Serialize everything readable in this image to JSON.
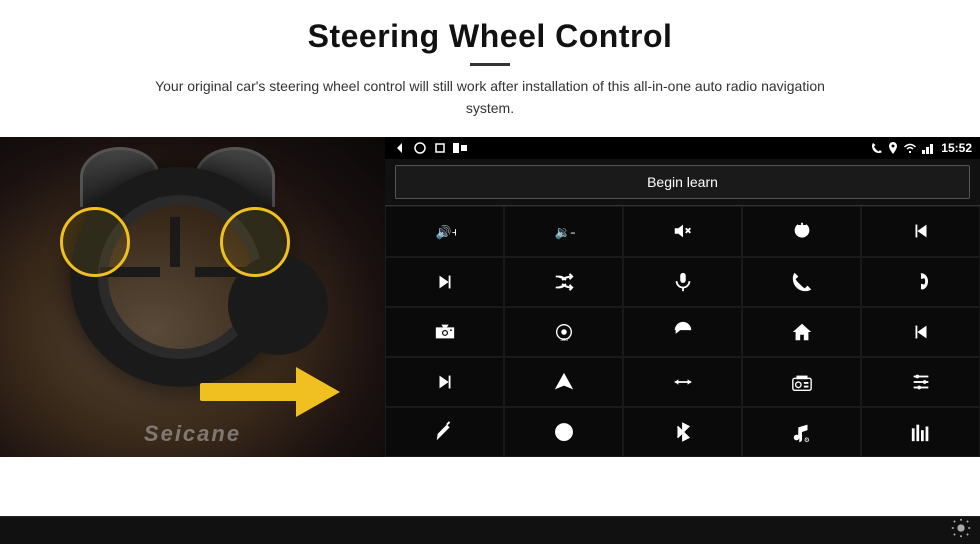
{
  "header": {
    "title": "Steering Wheel Control",
    "subtitle": "Your original car's steering wheel control will still work after installation of this all-in-one auto radio navigation system."
  },
  "status_bar": {
    "left_icons": [
      "back-arrow",
      "home-circle",
      "square"
    ],
    "right_icons": [
      "phone",
      "location",
      "wifi",
      "signal"
    ],
    "time": "15:52"
  },
  "begin_learn": {
    "label": "Begin learn"
  },
  "controls": [
    {
      "icon": "vol-up",
      "symbol": "🔊+"
    },
    {
      "icon": "vol-down",
      "symbol": "🔉–"
    },
    {
      "icon": "mute",
      "symbol": "🔇"
    },
    {
      "icon": "power",
      "symbol": "⏻"
    },
    {
      "icon": "prev-track",
      "symbol": "⏮"
    },
    {
      "icon": "next-track",
      "symbol": "⏭"
    },
    {
      "icon": "shuffle",
      "symbol": "⇄⏭"
    },
    {
      "icon": "mic",
      "symbol": "🎙"
    },
    {
      "icon": "phone-call",
      "symbol": "📞"
    },
    {
      "icon": "hang-up",
      "symbol": "↩"
    },
    {
      "icon": "camera",
      "symbol": "📷"
    },
    {
      "icon": "360-view",
      "symbol": "◉"
    },
    {
      "icon": "back",
      "symbol": "↺"
    },
    {
      "icon": "home",
      "symbol": "⌂"
    },
    {
      "icon": "skip-back",
      "symbol": "⏮"
    },
    {
      "icon": "fast-forward",
      "symbol": "⏩"
    },
    {
      "icon": "navigation",
      "symbol": "▲"
    },
    {
      "icon": "eq",
      "symbol": "⇌"
    },
    {
      "icon": "radio",
      "symbol": "📻"
    },
    {
      "icon": "settings-sliders",
      "symbol": "⊞"
    },
    {
      "icon": "pen",
      "symbol": "✏"
    },
    {
      "icon": "steering",
      "symbol": "⊙"
    },
    {
      "icon": "bluetooth",
      "symbol": "⁂"
    },
    {
      "icon": "music",
      "symbol": "♪"
    },
    {
      "icon": "spectrum",
      "symbol": "▌▌▌"
    }
  ],
  "bottom": {
    "gear_label": "Settings"
  },
  "seicane": "Seicane"
}
